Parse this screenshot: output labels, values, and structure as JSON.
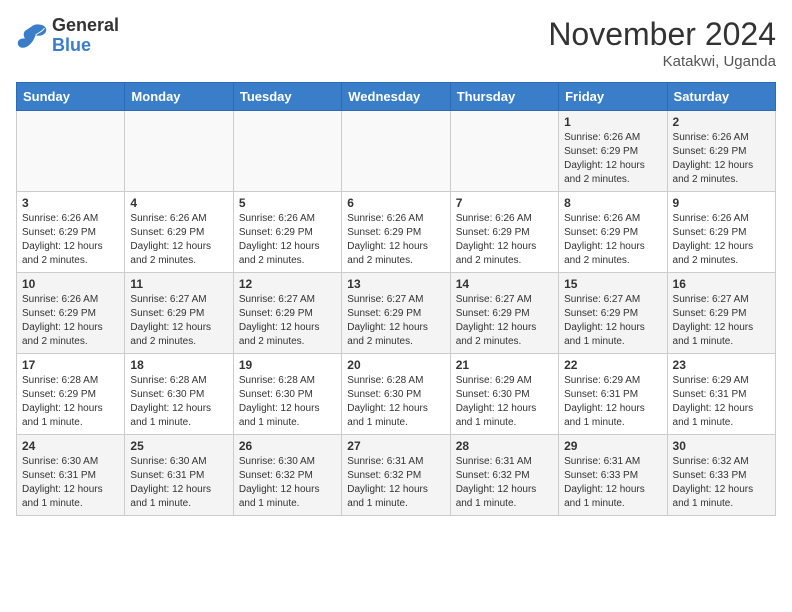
{
  "logo": {
    "line1": "General",
    "line2": "Blue"
  },
  "title": "November 2024",
  "subtitle": "Katakwi, Uganda",
  "weekdays": [
    "Sunday",
    "Monday",
    "Tuesday",
    "Wednesday",
    "Thursday",
    "Friday",
    "Saturday"
  ],
  "weeks": [
    [
      {
        "day": "",
        "info": ""
      },
      {
        "day": "",
        "info": ""
      },
      {
        "day": "",
        "info": ""
      },
      {
        "day": "",
        "info": ""
      },
      {
        "day": "",
        "info": ""
      },
      {
        "day": "1",
        "info": "Sunrise: 6:26 AM\nSunset: 6:29 PM\nDaylight: 12 hours and 2 minutes."
      },
      {
        "day": "2",
        "info": "Sunrise: 6:26 AM\nSunset: 6:29 PM\nDaylight: 12 hours and 2 minutes."
      }
    ],
    [
      {
        "day": "3",
        "info": "Sunrise: 6:26 AM\nSunset: 6:29 PM\nDaylight: 12 hours and 2 minutes."
      },
      {
        "day": "4",
        "info": "Sunrise: 6:26 AM\nSunset: 6:29 PM\nDaylight: 12 hours and 2 minutes."
      },
      {
        "day": "5",
        "info": "Sunrise: 6:26 AM\nSunset: 6:29 PM\nDaylight: 12 hours and 2 minutes."
      },
      {
        "day": "6",
        "info": "Sunrise: 6:26 AM\nSunset: 6:29 PM\nDaylight: 12 hours and 2 minutes."
      },
      {
        "day": "7",
        "info": "Sunrise: 6:26 AM\nSunset: 6:29 PM\nDaylight: 12 hours and 2 minutes."
      },
      {
        "day": "8",
        "info": "Sunrise: 6:26 AM\nSunset: 6:29 PM\nDaylight: 12 hours and 2 minutes."
      },
      {
        "day": "9",
        "info": "Sunrise: 6:26 AM\nSunset: 6:29 PM\nDaylight: 12 hours and 2 minutes."
      }
    ],
    [
      {
        "day": "10",
        "info": "Sunrise: 6:26 AM\nSunset: 6:29 PM\nDaylight: 12 hours and 2 minutes."
      },
      {
        "day": "11",
        "info": "Sunrise: 6:27 AM\nSunset: 6:29 PM\nDaylight: 12 hours and 2 minutes."
      },
      {
        "day": "12",
        "info": "Sunrise: 6:27 AM\nSunset: 6:29 PM\nDaylight: 12 hours and 2 minutes."
      },
      {
        "day": "13",
        "info": "Sunrise: 6:27 AM\nSunset: 6:29 PM\nDaylight: 12 hours and 2 minutes."
      },
      {
        "day": "14",
        "info": "Sunrise: 6:27 AM\nSunset: 6:29 PM\nDaylight: 12 hours and 2 minutes."
      },
      {
        "day": "15",
        "info": "Sunrise: 6:27 AM\nSunset: 6:29 PM\nDaylight: 12 hours and 1 minute."
      },
      {
        "day": "16",
        "info": "Sunrise: 6:27 AM\nSunset: 6:29 PM\nDaylight: 12 hours and 1 minute."
      }
    ],
    [
      {
        "day": "17",
        "info": "Sunrise: 6:28 AM\nSunset: 6:29 PM\nDaylight: 12 hours and 1 minute."
      },
      {
        "day": "18",
        "info": "Sunrise: 6:28 AM\nSunset: 6:30 PM\nDaylight: 12 hours and 1 minute."
      },
      {
        "day": "19",
        "info": "Sunrise: 6:28 AM\nSunset: 6:30 PM\nDaylight: 12 hours and 1 minute."
      },
      {
        "day": "20",
        "info": "Sunrise: 6:28 AM\nSunset: 6:30 PM\nDaylight: 12 hours and 1 minute."
      },
      {
        "day": "21",
        "info": "Sunrise: 6:29 AM\nSunset: 6:30 PM\nDaylight: 12 hours and 1 minute."
      },
      {
        "day": "22",
        "info": "Sunrise: 6:29 AM\nSunset: 6:31 PM\nDaylight: 12 hours and 1 minute."
      },
      {
        "day": "23",
        "info": "Sunrise: 6:29 AM\nSunset: 6:31 PM\nDaylight: 12 hours and 1 minute."
      }
    ],
    [
      {
        "day": "24",
        "info": "Sunrise: 6:30 AM\nSunset: 6:31 PM\nDaylight: 12 hours and 1 minute."
      },
      {
        "day": "25",
        "info": "Sunrise: 6:30 AM\nSunset: 6:31 PM\nDaylight: 12 hours and 1 minute."
      },
      {
        "day": "26",
        "info": "Sunrise: 6:30 AM\nSunset: 6:32 PM\nDaylight: 12 hours and 1 minute."
      },
      {
        "day": "27",
        "info": "Sunrise: 6:31 AM\nSunset: 6:32 PM\nDaylight: 12 hours and 1 minute."
      },
      {
        "day": "28",
        "info": "Sunrise: 6:31 AM\nSunset: 6:32 PM\nDaylight: 12 hours and 1 minute."
      },
      {
        "day": "29",
        "info": "Sunrise: 6:31 AM\nSunset: 6:33 PM\nDaylight: 12 hours and 1 minute."
      },
      {
        "day": "30",
        "info": "Sunrise: 6:32 AM\nSunset: 6:33 PM\nDaylight: 12 hours and 1 minute."
      }
    ]
  ]
}
